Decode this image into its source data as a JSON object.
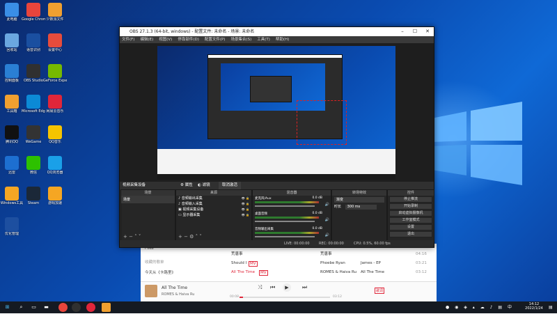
{
  "desktop": {
    "icons": [
      {
        "label": "此电脑",
        "icon": "computer-icon",
        "color": "#3a8ee6"
      },
      {
        "label": "Google Chrome",
        "icon": "chrome-icon",
        "color": "#e8453c"
      },
      {
        "label": "少数派文件",
        "icon": "folder-icon",
        "color": "#f0a030"
      },
      {
        "label": "回收站",
        "icon": "recycle-bin-icon",
        "color": "#6aa7e0"
      },
      {
        "label": "语音识别",
        "icon": "app-icon",
        "color": "#1a4fa0"
      },
      {
        "label": "设置中心",
        "icon": "app-icon",
        "color": "#e64c3c"
      },
      {
        "label": "控制面板",
        "icon": "control-panel-icon",
        "color": "#2a7fd4"
      },
      {
        "label": "OBS Studio",
        "icon": "obs-icon",
        "color": "#303030"
      },
      {
        "label": "GeForce Experience",
        "icon": "nvidia-icon",
        "color": "#76b900"
      },
      {
        "label": "工具箱",
        "icon": "folder-icon",
        "color": "#f0a030"
      },
      {
        "label": "Microsoft Edge",
        "icon": "edge-icon",
        "color": "#0c8ad6"
      },
      {
        "label": "网易云音乐",
        "icon": "netease-icon",
        "color": "#e0263a"
      },
      {
        "label": "腾讯QQ",
        "icon": "qq-icon",
        "color": "#111"
      },
      {
        "label": "WeGame",
        "icon": "app-icon",
        "color": "#333"
      },
      {
        "label": "QQ音乐",
        "icon": "qqmusic-icon",
        "color": "#f5c400"
      },
      {
        "label": "迅雷",
        "icon": "app-icon",
        "color": "#1d6fd1"
      },
      {
        "label": "微信",
        "icon": "wechat-icon",
        "color": "#2dc100"
      },
      {
        "label": "QQ浏览器",
        "icon": "app-icon",
        "color": "#1aa0e8"
      },
      {
        "label": "Windows工具",
        "icon": "app-icon",
        "color": "#f5a623"
      },
      {
        "label": "Steam",
        "icon": "steam-icon",
        "color": "#1b2838"
      },
      {
        "label": "游戏加速",
        "icon": "app-icon",
        "color": "#f5a623"
      },
      {
        "label": "优化管理",
        "icon": "app-icon",
        "color": "#1d4fa0"
      }
    ]
  },
  "obs": {
    "title": "OBS 27.1.3 (64-bit, windows) - 配置文件: 未命名 - 场景: 未命名",
    "menu": [
      "文件(F)",
      "编辑(E)",
      "视图(V)",
      "停靠部件(D)",
      "配置文件(P)",
      "场景集合(S)",
      "工具(T)",
      "帮助(H)"
    ],
    "toolbar": {
      "source_label": "视频采集设备",
      "props_label": "属性",
      "filters_label": "滤镜",
      "deactivate_label": "取消激活"
    },
    "docks": {
      "scenes": {
        "title": "场景",
        "items": [
          "场景"
        ]
      },
      "sources": {
        "title": "来源",
        "items": [
          "音频输出采集",
          "音频输入采集",
          "视频采集设备",
          "显示器采集"
        ]
      },
      "mixer": {
        "title": "混音器",
        "channels": [
          {
            "name": "麦克风/Aux",
            "db": "0.0 dB"
          },
          {
            "name": "桌面音频",
            "db": "0.0 dB"
          },
          {
            "name": "音频输出采集",
            "db": "0.0 dB"
          }
        ]
      },
      "transitions": {
        "title": "转场特效",
        "type": "渐变",
        "duration_label": "时长",
        "duration": "300 ms"
      },
      "controls": {
        "title": "控件",
        "buttons": [
          "停止推流",
          "开始录制",
          "启动虚拟摄像机",
          "工作室模式",
          "设置",
          "退出"
        ]
      }
    },
    "status": {
      "live": "LIVE: 00:00:00",
      "rec": "REC: 00:00:00",
      "cpu": "CPU: 0.5%, 60.00 fps"
    }
  },
  "music": {
    "sidebar": [
      "i like",
      "收藏的歌单",
      "今天从《卡路里》"
    ],
    "tracks": [
      {
        "title": "荒唐事",
        "artist": "",
        "album": "荒唐事",
        "duration": "04:16",
        "badge": ""
      },
      {
        "title": "Should I",
        "badge": "MV",
        "artist": "Phoebe Ryan",
        "album": "James - EP",
        "duration": "03:21"
      },
      {
        "title": "All The Time",
        "badge": "MV",
        "artist": "ROMES & Haiva Ru",
        "album": "All The Time",
        "duration": "03:12"
      }
    ],
    "now_playing": {
      "title": "All The Time",
      "artist": "ROMES & Haiva Ru",
      "time": "00:08",
      "total": "03:12",
      "lyrics": "歌词"
    }
  },
  "taskbar": {
    "apps": [
      "chrome-icon",
      "obs-icon",
      "netease-icon",
      "ge-icon"
    ],
    "time": "14:12",
    "date": "2022/1/24"
  }
}
